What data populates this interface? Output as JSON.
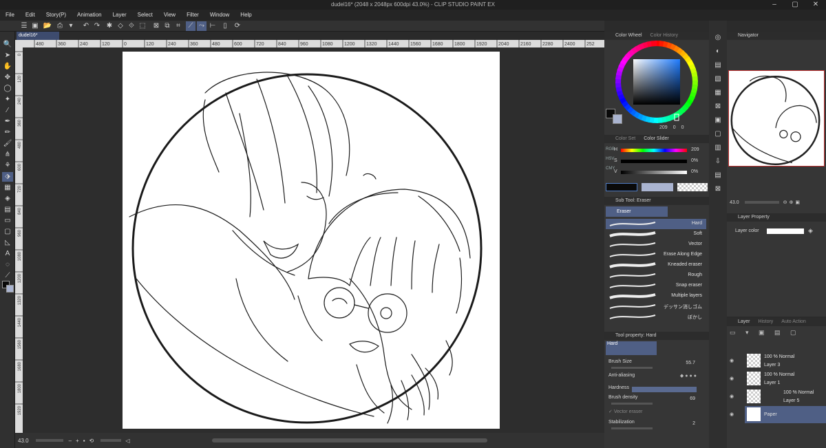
{
  "window": {
    "title": "dudel16* (2048 x 2048px 600dpi 43.0%) - CLIP STUDIO PAINT EX"
  },
  "menu": [
    "File",
    "Edit",
    "Story(P)",
    "Animation",
    "Layer",
    "Select",
    "View",
    "Filter",
    "Window",
    "Help"
  ],
  "document": {
    "tab": "dudel16*"
  },
  "ruler": {
    "top_ticks": [
      "480",
      "360",
      "240",
      "120",
      "0",
      "120",
      "240",
      "360",
      "480",
      "600",
      "720",
      "840",
      "960",
      "1080",
      "1200",
      "1320",
      "1440",
      "1560",
      "1680",
      "1800",
      "1920",
      "2040",
      "2160",
      "2280",
      "2400",
      "252"
    ],
    "left_ticks": [
      "0",
      "120",
      "240",
      "360",
      "480",
      "600",
      "720",
      "840",
      "960",
      "1080",
      "1200",
      "1320",
      "1440",
      "1560",
      "1680",
      "1800",
      "1920"
    ]
  },
  "status": {
    "zoom": "43.0"
  },
  "color_wheel": {
    "tabs": [
      "Color Wheel",
      "Color History"
    ],
    "hue": "209",
    "sat": "0",
    "val": "0",
    "main_color": "#0a0a0a",
    "sub_color": "#aab4d0"
  },
  "color_slider": {
    "tabs": [
      "Color Set",
      "Color Slider"
    ],
    "modes": [
      "RGB",
      "HSV",
      "CMY"
    ],
    "rows": [
      {
        "label": "H",
        "value": "209"
      },
      {
        "label": "S",
        "value": "0%"
      },
      {
        "label": "V",
        "value": "0%"
      }
    ]
  },
  "subtool": {
    "title": "Sub Tool: Eraser",
    "group": "Eraser",
    "items": [
      "Hard",
      "Soft",
      "Vector",
      "Erase Along Edge",
      "Kneaded eraser",
      "Rough",
      "Snap eraser",
      "Multiple layers",
      "デッサン消しゴム",
      "ぼかし"
    ],
    "selected": 0
  },
  "toolprop": {
    "title": "Tool property: Hard",
    "preview": "Hard",
    "brush_size_label": "Brush Size",
    "brush_size": "55.7",
    "antialias_label": "Anti-aliasing",
    "hardness_label": "Hardness",
    "density_label": "Brush density",
    "density": "69",
    "vector_label": "Vector eraser",
    "stab_label": "Stabilization",
    "stab": "2"
  },
  "navigator": {
    "title": "Navigator",
    "zoom": "43.0"
  },
  "layerprop": {
    "title": "Layer Property",
    "color_label": "Layer color"
  },
  "layers": {
    "tabs": [
      "Layer",
      "History",
      "Auto Action"
    ],
    "items": [
      {
        "mode": "100 % Normal",
        "name": "Layer 3"
      },
      {
        "mode": "100 % Normal",
        "name": "Layer 1"
      },
      {
        "mode": "100 % Normal",
        "name": "Layer 5"
      },
      {
        "mode": "",
        "name": "Paper"
      }
    ]
  }
}
